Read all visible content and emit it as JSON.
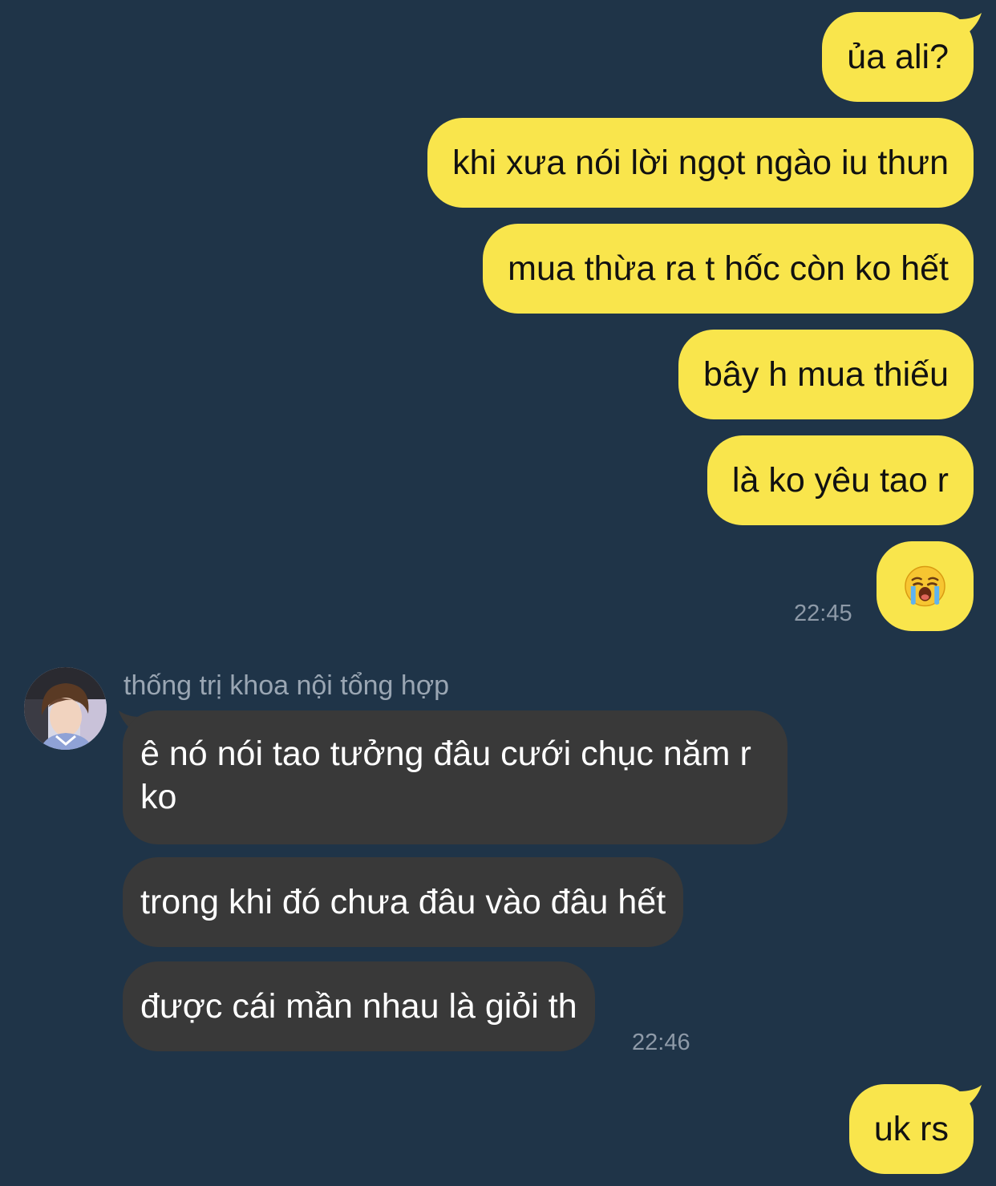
{
  "conversation": {
    "outgoing_group_1": [
      "ủa ali?",
      "khi xưa nói lời ngọt ngào iu thưn",
      "mua thừa ra t hốc còn ko hết",
      "bây h mua thiếu",
      "là ko yêu tao r"
    ],
    "outgoing_group_1_emoji": "loudly-crying-face",
    "outgoing_group_1_time": "22:45",
    "incoming_sender": "thống trị khoa nội tổng hợp",
    "incoming_group": [
      "ê nó nói tao tưởng đâu cưới chục năm r ko",
      "trong khi đó chưa đâu vào đâu hết",
      "được cái mần nhau là giỏi th"
    ],
    "incoming_group_time": "22:46",
    "outgoing_group_2": [
      "uk rs"
    ]
  },
  "colors": {
    "background": "#1f3448",
    "outgoing_bubble": "#f9e54c",
    "incoming_bubble": "#393939",
    "timestamp": "#8e9aa8"
  }
}
